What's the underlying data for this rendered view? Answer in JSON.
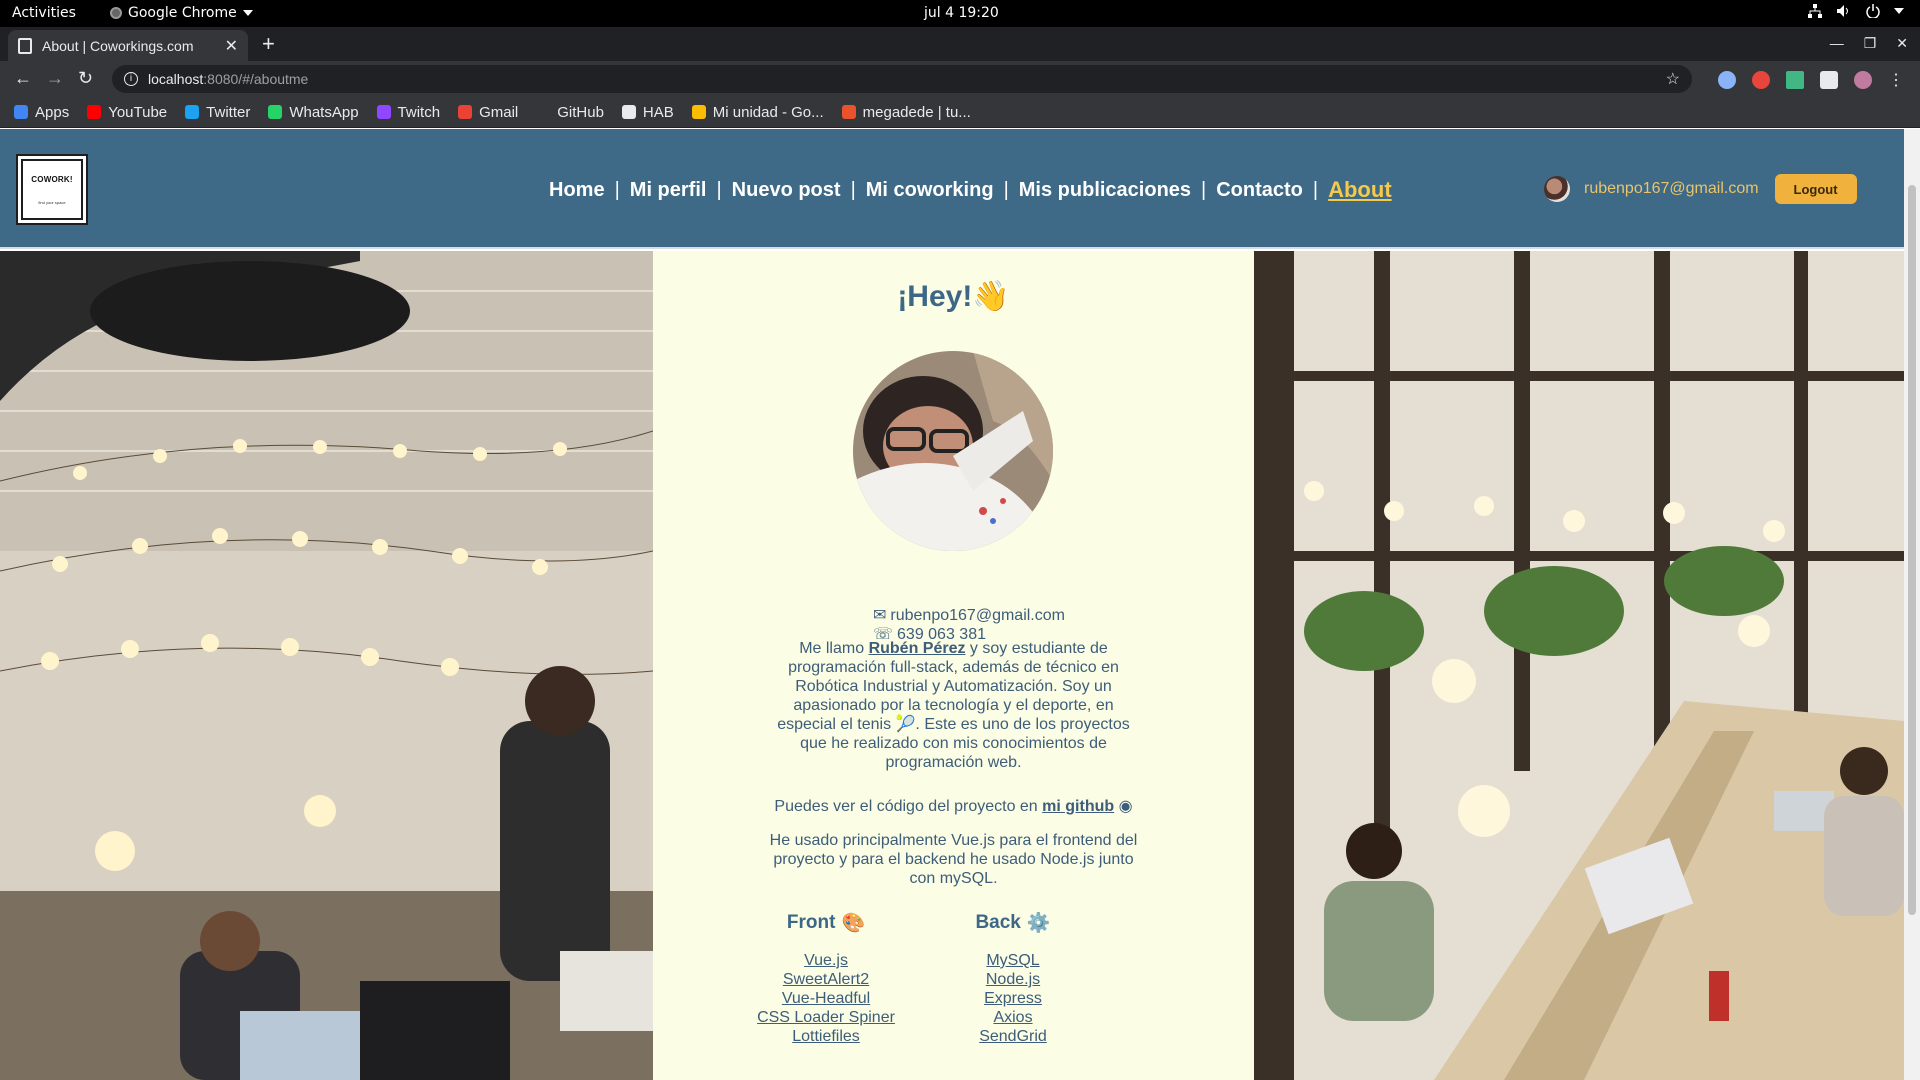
{
  "os": {
    "activities": "Activities",
    "app_name": "Google Chrome",
    "clock": "jul 4  19:20"
  },
  "browser": {
    "tab_title": "About | Coworkings.com",
    "url_host": "localhost",
    "url_path": ":8080/#/aboutme",
    "bookmarks": [
      {
        "label": "Apps",
        "color": "#4285f4"
      },
      {
        "label": "YouTube",
        "color": "#ff0000"
      },
      {
        "label": "Twitter",
        "color": "#1da1f2"
      },
      {
        "label": "WhatsApp",
        "color": "#25d366"
      },
      {
        "label": "Twitch",
        "color": "#9146ff"
      },
      {
        "label": "Gmail",
        "color": "#ea4335"
      },
      {
        "label": "GitHub",
        "color": "#35363a"
      },
      {
        "label": "HAB",
        "color": "#e8eaed"
      },
      {
        "label": "Mi unidad - Go...",
        "color": "#fbbc04"
      },
      {
        "label": "megadede | tu...",
        "color": "#e8522d"
      }
    ]
  },
  "site": {
    "logo_text": "COWORK!",
    "logo_sub": "find your space",
    "nav": [
      {
        "label": "Home"
      },
      {
        "label": "Mi perfil"
      },
      {
        "label": "Nuevo post"
      },
      {
        "label": "Mi coworking"
      },
      {
        "label": "Mis publicaciones"
      },
      {
        "label": "Contacto"
      },
      {
        "label": "About",
        "active": true
      }
    ],
    "user_email": "rubenpo167@gmail.com",
    "logout_label": "Logout"
  },
  "about": {
    "title": "¡Hey!👋",
    "email": "rubenpo167@gmail.com",
    "phone": "639 063 381",
    "bio_pre": "Me llamo ",
    "bio_name": "Rubén Pérez",
    "bio_post": " y soy estudiante de programación full-stack, además de técnico en Robótica Industrial y Automatización. Soy un apasionado por la tecnología y el deporte, en especial el tenis 🎾. Este es uno de los proyectos que he realizado con mis conocimientos de programación web.",
    "repo_pre": "Puedes ver el código del proyecto en ",
    "repo_link": "mi github",
    "stack_note": "He usado principalmente Vue.js para el frontend del proyecto y para el backend he usado Node.js junto con mySQL.",
    "front_title": "Front",
    "front_icon": "🎨",
    "front_items": [
      "Vue.js",
      "SweetAlert2",
      "Vue-Headful",
      "CSS Loader Spiner",
      "Lottiefiles"
    ],
    "back_title": "Back",
    "back_icon": "⚙️",
    "back_items": [
      "MySQL",
      "Node.js",
      "Express",
      "Axios",
      "SendGrid"
    ]
  }
}
